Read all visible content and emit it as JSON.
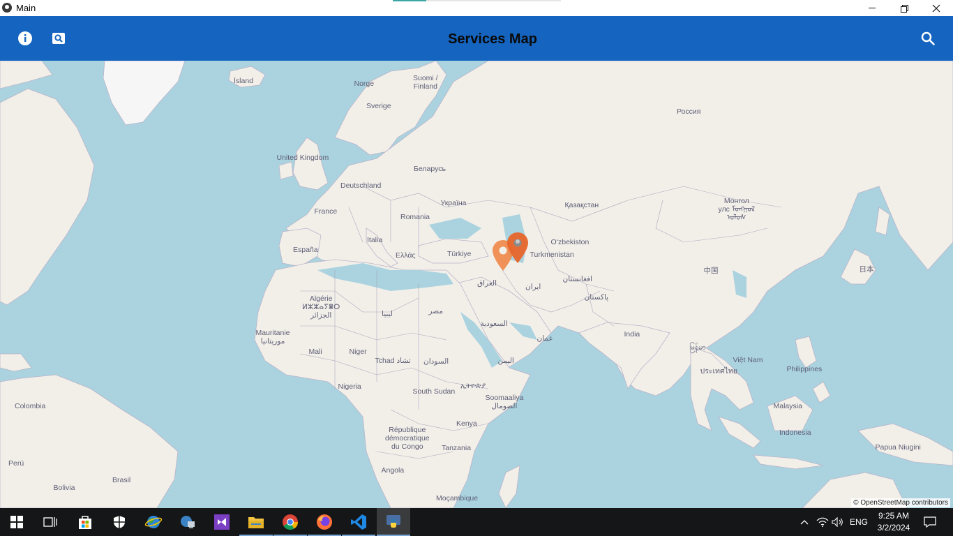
{
  "window": {
    "title": "Main",
    "minimize_icon": "minimize-icon",
    "maximize_icon": "restore-icon",
    "close_icon": "close-icon"
  },
  "appbar": {
    "title": "Services Map",
    "left_icons": [
      "info-icon",
      "image-search-icon"
    ],
    "right_icon": "search-icon",
    "background": "#1565c0"
  },
  "map": {
    "attribution": "© OpenStreetMap contributors",
    "labels": [
      {
        "text": "Ísland"
      },
      {
        "text": "Norge"
      },
      {
        "text": "Suomi /\nFinland"
      },
      {
        "text": "Sverige"
      },
      {
        "text": "Россия"
      },
      {
        "text": "United Kingdom"
      },
      {
        "text": "Беларусь"
      },
      {
        "text": "Deutschland"
      },
      {
        "text": "France"
      },
      {
        "text": "Україна"
      },
      {
        "text": "Қазақстан"
      },
      {
        "text": "Монгол\nулс ᠮᠤᠩᠭᠤᠯ\nᠤᠯᠤᠰ"
      },
      {
        "text": "Romania"
      },
      {
        "text": "España"
      },
      {
        "text": "Italia"
      },
      {
        "text": "Ελλάς"
      },
      {
        "text": "Türkiye"
      },
      {
        "text": "Oʻzbekiston"
      },
      {
        "text": "Turkmenistan"
      },
      {
        "text": "中国"
      },
      {
        "text": "日本"
      },
      {
        "text": "العراق"
      },
      {
        "text": "ایران"
      },
      {
        "text": "افغانستان"
      },
      {
        "text": "پاکستان"
      },
      {
        "text": "Algérie\nⵍⵣⵣⴰⵢⴻⵔ\nالجزائر"
      },
      {
        "text": "ليبيا"
      },
      {
        "text": "مصر"
      },
      {
        "text": "السعودية"
      },
      {
        "text": "India"
      },
      {
        "text": "Mauritanie\nموريتانيا"
      },
      {
        "text": "Mali"
      },
      {
        "text": "Niger"
      },
      {
        "text": "عمان"
      },
      {
        "text": "မြန်မာ"
      },
      {
        "text": "Tchad تشاد"
      },
      {
        "text": "السودان"
      },
      {
        "text": "اليمن"
      },
      {
        "text": "Việt Nam"
      },
      {
        "text": "ประเทศไทย"
      },
      {
        "text": "Philippines"
      },
      {
        "text": "Nigeria"
      },
      {
        "text": "ኢትዮጵያ"
      },
      {
        "text": "South Sudan"
      },
      {
        "text": "Soomaaliya\nالصومال"
      },
      {
        "text": "Colombia"
      },
      {
        "text": "Malaysia"
      },
      {
        "text": "Kenya"
      },
      {
        "text": "République\ndémocratique\ndu Congo"
      },
      {
        "text": "Indonesia"
      },
      {
        "text": "Tanzania"
      },
      {
        "text": "Papua Niugini"
      },
      {
        "text": "Perú"
      },
      {
        "text": "Angola"
      },
      {
        "text": "Brasil"
      },
      {
        "text": "Bolivia"
      },
      {
        "text": "Moçambique"
      }
    ],
    "markers": [
      {
        "name": "marker-1",
        "color": "#f08a4b"
      },
      {
        "name": "marker-2",
        "color": "#e8652a"
      }
    ],
    "colors": {
      "water": "#aad3df",
      "land": "#f2efe9",
      "border": "#a4a0b8",
      "ice": "#f6f6f6"
    }
  },
  "taskbar": {
    "apps": [
      {
        "name": "start-button",
        "icon": "windows-icon"
      },
      {
        "name": "task-view-button",
        "icon": "task-view-icon"
      },
      {
        "name": "store-button",
        "icon": "store-icon"
      },
      {
        "name": "security-button",
        "icon": "shield-icon"
      },
      {
        "name": "ie-button",
        "icon": "globe-icon"
      },
      {
        "name": "network-app-button",
        "icon": "network-icon"
      },
      {
        "name": "visual-studio-button",
        "icon": "visual-studio-icon"
      },
      {
        "name": "file-explorer-button",
        "icon": "folder-icon"
      },
      {
        "name": "chrome-button",
        "icon": "chrome-icon"
      },
      {
        "name": "firefox-button",
        "icon": "firefox-icon"
      },
      {
        "name": "vscode-button",
        "icon": "vscode-icon"
      },
      {
        "name": "python-button",
        "icon": "python-icon"
      }
    ],
    "tray": {
      "language": "ENG",
      "time": "9:25 AM",
      "date": "3/2/2024"
    }
  }
}
